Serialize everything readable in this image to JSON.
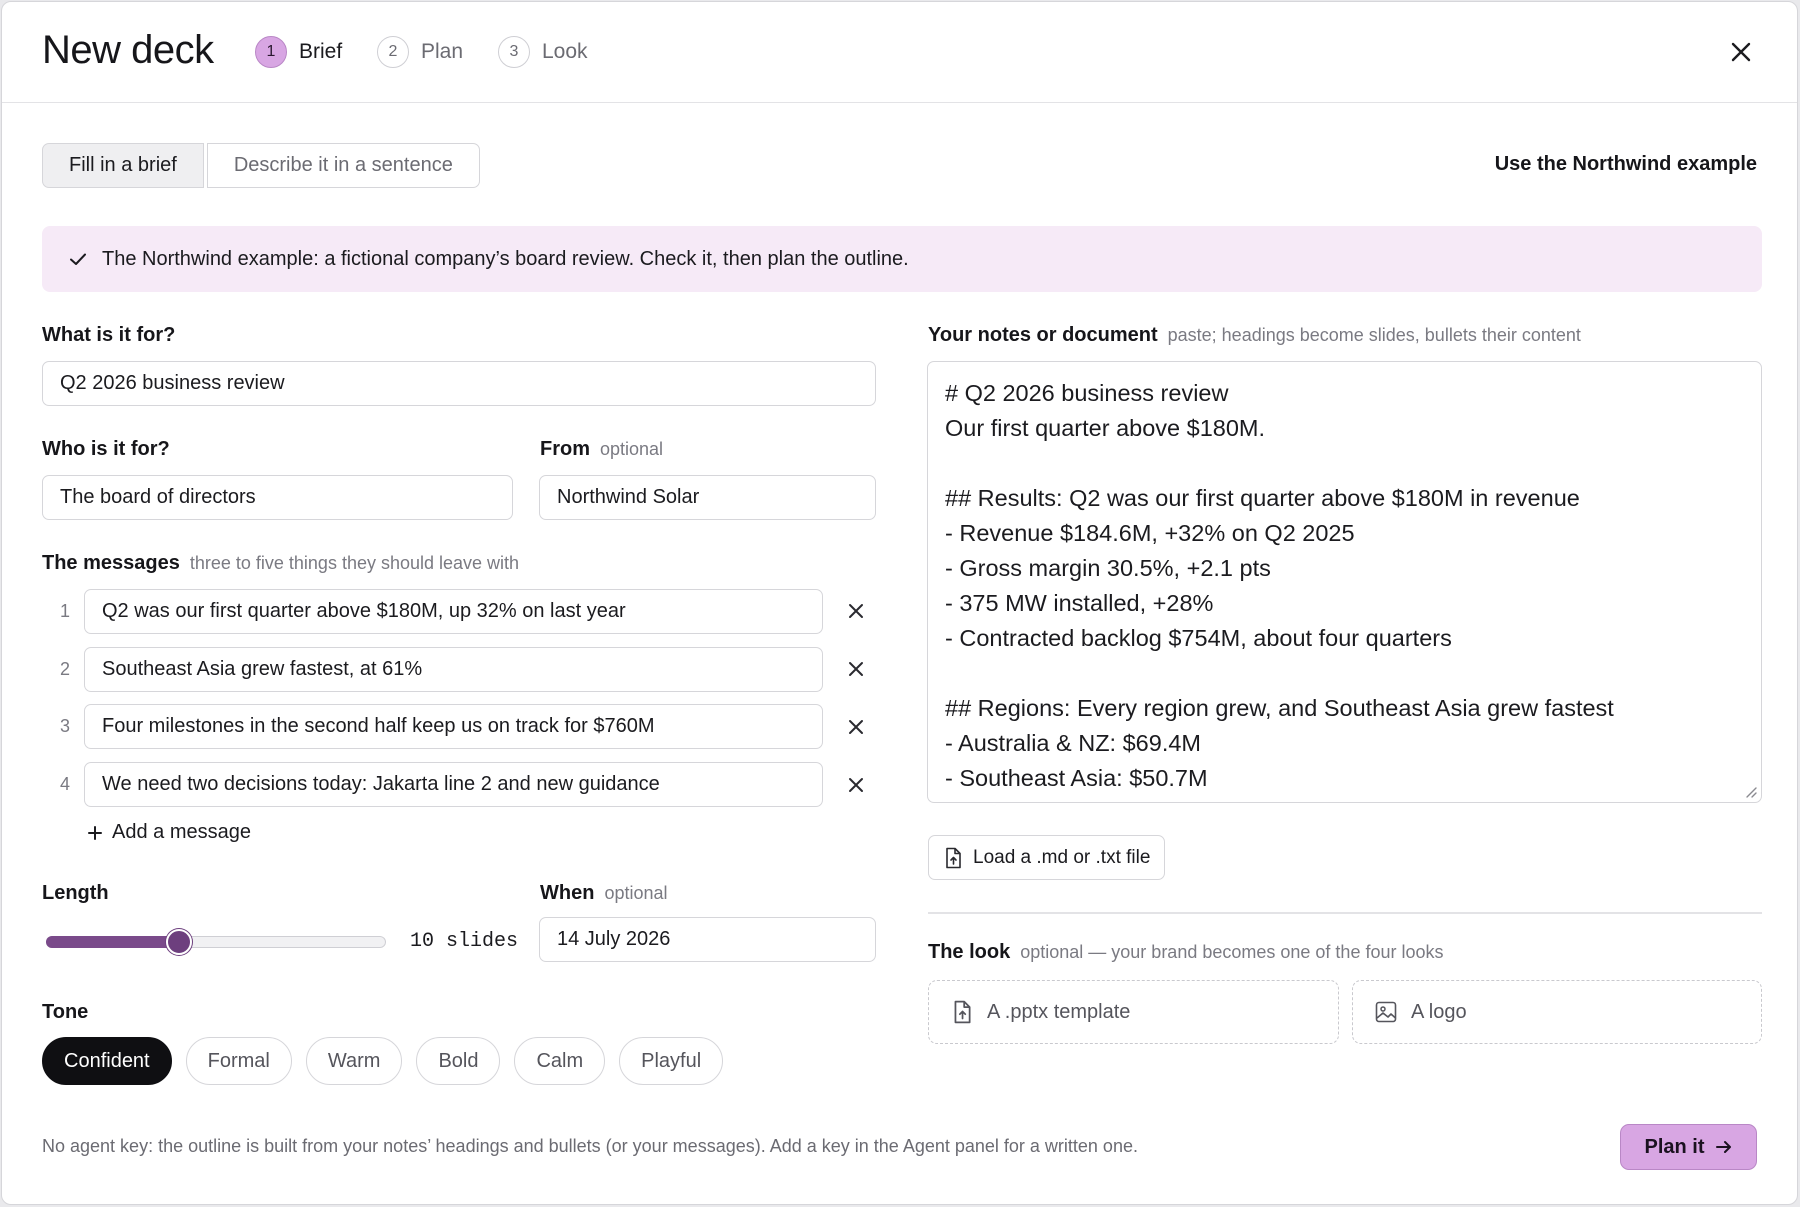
{
  "header": {
    "title": "New deck",
    "steps": [
      {
        "num": "1",
        "label": "Brief"
      },
      {
        "num": "2",
        "label": "Plan"
      },
      {
        "num": "3",
        "label": "Look"
      }
    ]
  },
  "mode_tabs": [
    "Fill in a brief",
    "Describe it in a sentence"
  ],
  "example_link": "Use the Northwind example",
  "banner": "The Northwind example: a fictional company’s board review. Check it, then plan the outline.",
  "purpose": {
    "label": "What is it for?",
    "value": "Q2 2026 business review"
  },
  "audience": {
    "label": "Who is it for?",
    "value": "The board of directors"
  },
  "from": {
    "label": "From",
    "hint": "optional",
    "value": "Northwind Solar"
  },
  "messages": {
    "label": "The messages",
    "hint": "three to five things they should leave with",
    "items": [
      {
        "num": "1",
        "text": "Q2 was our first quarter above $180M, up 32% on last year"
      },
      {
        "num": "2",
        "text": "Southeast Asia grew fastest, at 61%"
      },
      {
        "num": "3",
        "text": "Four milestones in the second half keep us on track for $760M"
      },
      {
        "num": "4",
        "text": "We need two decisions today: Jakarta line 2 and new guidance"
      }
    ],
    "add_label": "Add a message"
  },
  "length": {
    "label": "Length",
    "value_label": "10 slides",
    "fraction": 0.39
  },
  "when": {
    "label": "When",
    "hint": "optional",
    "value": "14 July 2026"
  },
  "tone": {
    "label": "Tone",
    "options": [
      "Confident",
      "Formal",
      "Warm",
      "Bold",
      "Calm",
      "Playful"
    ],
    "selected": "Confident"
  },
  "notes": {
    "label": "Your notes or document",
    "hint": "paste; headings become slides, bullets their content",
    "lines": [
      "# Q2 2026 business review",
      "Our first quarter above $180M.",
      "",
      "## Results: Q2 was our first quarter above $180M in revenue",
      "- Revenue $184.6M, +32% on Q2 2025",
      "- Gross margin 30.5%, +2.1 pts",
      "- 375 MW installed, +28%",
      "- Contracted backlog $754M, about four quarters",
      "",
      "## Regions: Every region grew, and Southeast Asia grew fastest",
      "- Australia & NZ: $69.4M",
      "- Southeast Asia: $50.7M"
    ]
  },
  "load_file_label": "Load a .md or .txt file",
  "look": {
    "label": "The look",
    "hint": "optional — your brand becomes one of the four looks",
    "template_label": "A .pptx template",
    "logo_label": "A logo"
  },
  "footer_note": "No agent key: the outline is built from your notes’ headings and bullets (or your messages). Add a key in the Agent panel for a written one.",
  "plan_button": "Plan it",
  "colors": {
    "accent": "#d8a6e3",
    "accent_dark": "#6d3f7e",
    "banner_bg": "#f6eaf7"
  }
}
